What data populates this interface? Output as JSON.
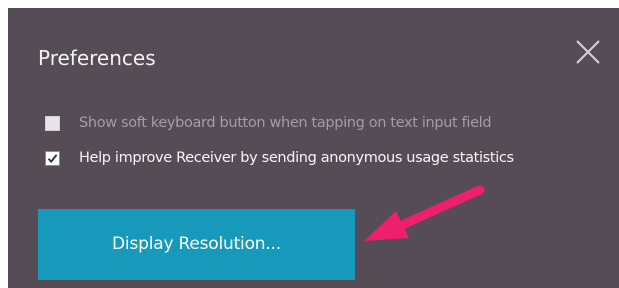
{
  "dialog": {
    "title": "Preferences",
    "close_icon": "close-icon",
    "options": [
      {
        "label": "Show soft keyboard button when tapping on text input field",
        "checked": false,
        "enabled": false
      },
      {
        "label": "Help improve Receiver by sending anonymous usage statistics",
        "checked": true,
        "enabled": true
      }
    ],
    "display_resolution_label": "Display Resolution..."
  },
  "colors": {
    "dialog_background": "#564c55",
    "button_background": "#1799bb",
    "annotation_arrow": "#ee1f6b"
  },
  "annotation": {
    "icon": "arrow-pointer-icon"
  }
}
